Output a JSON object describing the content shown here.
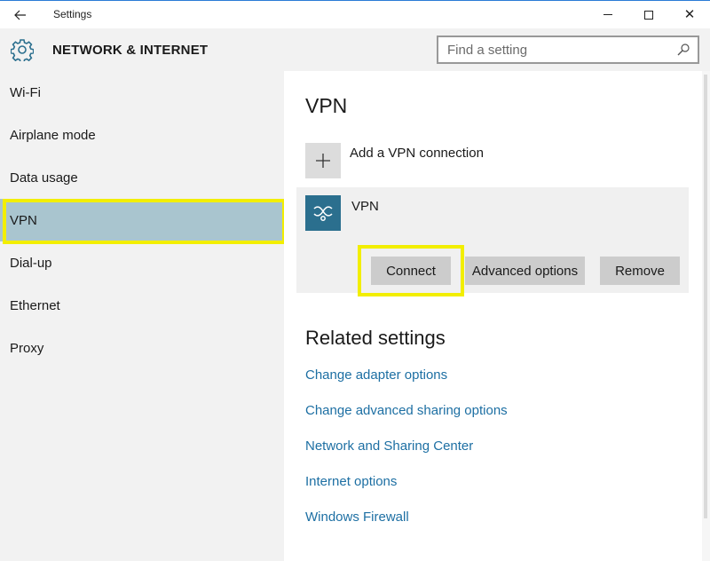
{
  "window": {
    "title": "Settings",
    "back_icon": "back-arrow-icon",
    "controls": [
      "minimize-icon",
      "maximize-icon",
      "close-icon"
    ]
  },
  "header": {
    "icon": "gear-icon",
    "title": "NETWORK & INTERNET",
    "search_placeholder": "Find a setting"
  },
  "sidebar": {
    "items": [
      {
        "label": "Wi-Fi"
      },
      {
        "label": "Airplane mode"
      },
      {
        "label": "Data usage"
      },
      {
        "label": "VPN",
        "selected": true
      },
      {
        "label": "Dial-up"
      },
      {
        "label": "Ethernet"
      },
      {
        "label": "Proxy"
      }
    ]
  },
  "main": {
    "title": "VPN",
    "add_connection_label": "Add a VPN connection",
    "connection": {
      "name": "VPN",
      "icon": "vpn-icon"
    },
    "buttons": {
      "connect": "Connect",
      "advanced": "Advanced options",
      "remove": "Remove"
    },
    "related": {
      "title": "Related settings",
      "links": [
        "Change adapter options",
        "Change advanced sharing options",
        "Network and Sharing Center",
        "Internet options",
        "Windows Firewall"
      ]
    }
  },
  "colors": {
    "selected_nav": "#a9c5cf",
    "highlight": "#f2ee00",
    "link": "#1d6fa3",
    "vpn_tile": "#2b6f8e"
  }
}
